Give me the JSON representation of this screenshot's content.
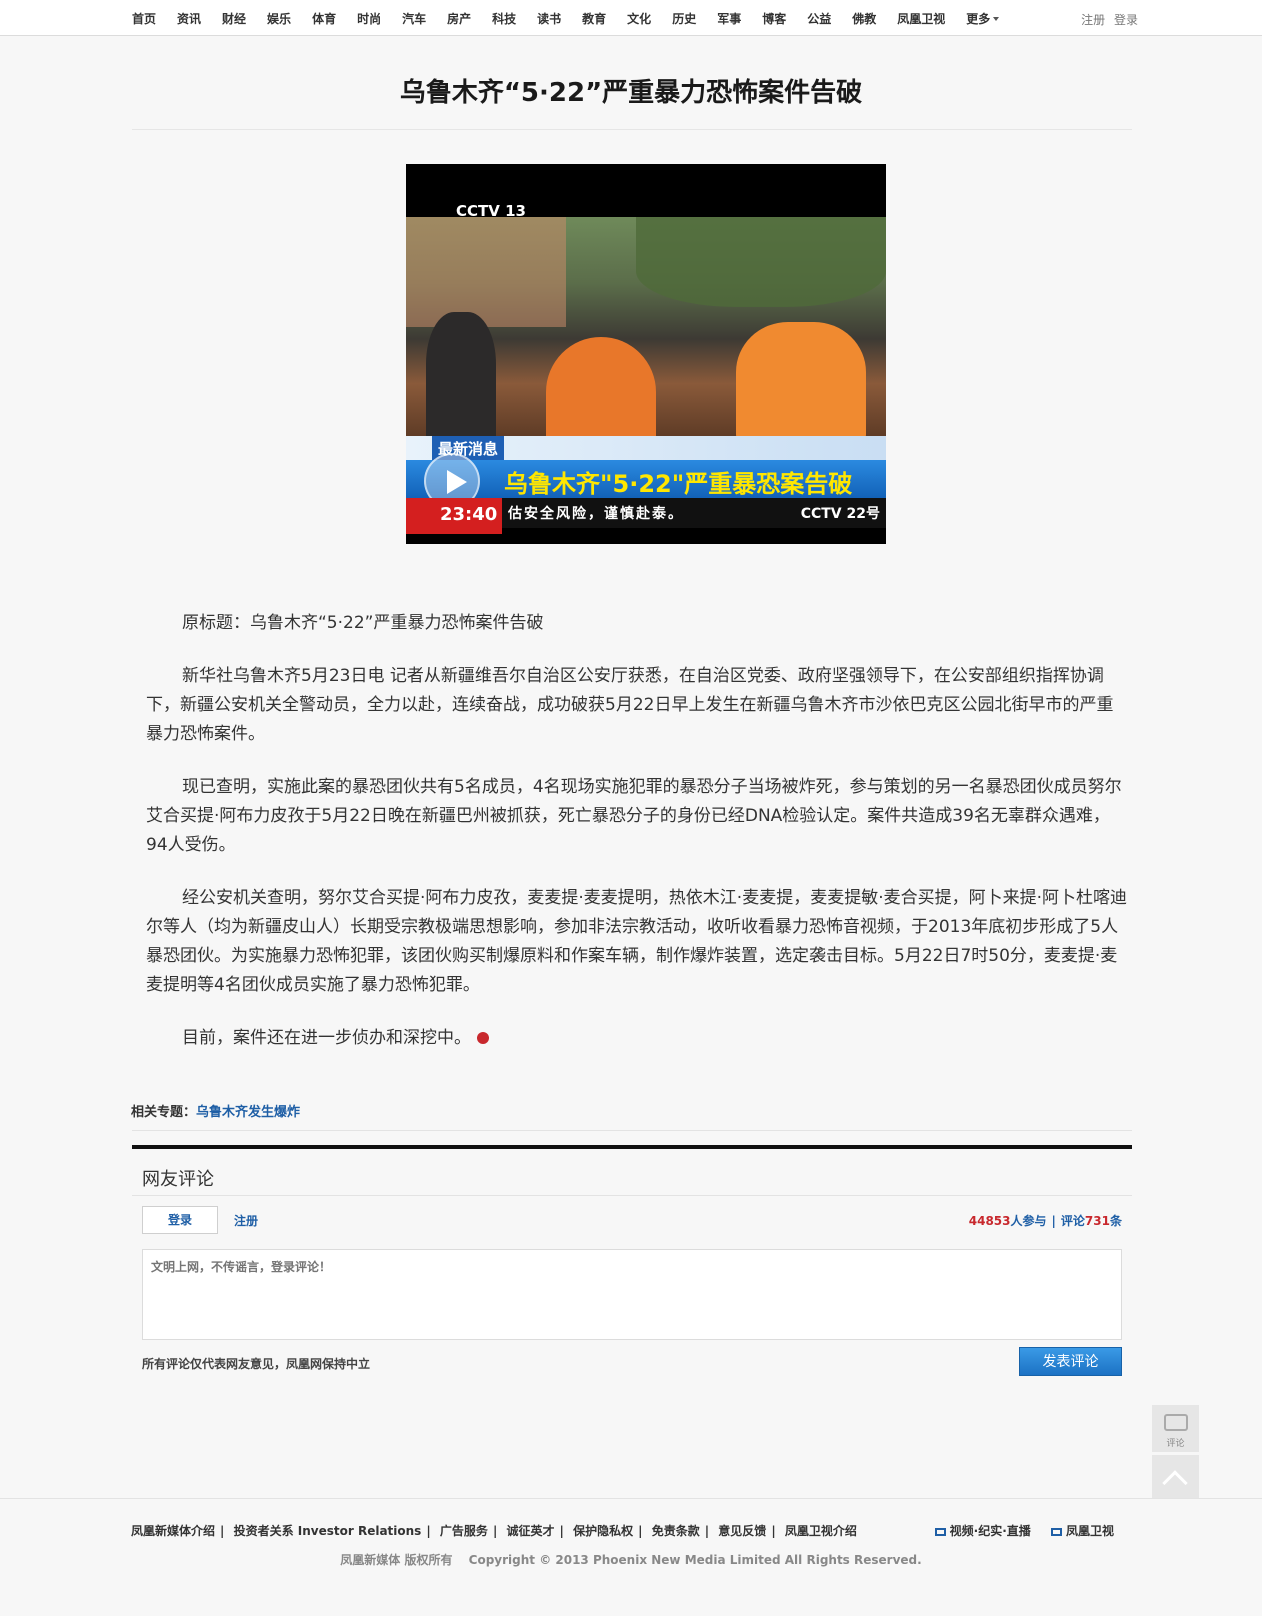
{
  "nav": {
    "items": [
      "首页",
      "资讯",
      "财经",
      "娱乐",
      "体育",
      "时尚",
      "汽车",
      "房产",
      "科技",
      "读书",
      "教育",
      "文化",
      "历史",
      "军事",
      "博客",
      "公益",
      "佛教",
      "凤凰卫视",
      "更多"
    ],
    "register": "注册",
    "login": "登录"
  },
  "article": {
    "title": "乌鲁木齐“5·22”严重暴力恐怖案件告破",
    "video": {
      "channel_logo": "CCTV 13",
      "breaking_label": "最新消息",
      "headline_overlay": "乌鲁木齐\"5·22\"严重暴恐案告破",
      "time": "23:40",
      "ticker": "估安全风险，谨慎赴泰。",
      "ticker_right": "CCTV 22号"
    },
    "paragraphs": [
      "原标题：乌鲁木齐“5·22”严重暴力恐怖案件告破",
      "新华社乌鲁木齐5月23日电  记者从新疆维吾尔自治区公安厅获悉，在自治区党委、政府坚强领导下，在公安部组织指挥协调下，新疆公安机关全警动员，全力以赴，连续奋战，成功破获5月22日早上发生在新疆乌鲁木齐市沙依巴克区公园北街早市的严重暴力恐怖案件。",
      "现已查明，实施此案的暴恐团伙共有5名成员，4名现场实施犯罪的暴恐分子当场被炸死，参与策划的另一名暴恐团伙成员努尔艾合买提·阿布力皮孜于5月22日晚在新疆巴州被抓获，死亡暴恐分子的身份已经DNA检验认定。案件共造成39名无辜群众遇难，94人受伤。",
      "经公安机关查明，努尔艾合买提·阿布力皮孜，麦麦提·麦麦提明，热依木江·麦麦提，麦麦提敏·麦合买提，阿卜来提·阿卜杜喀迪尔等人（均为新疆皮山人）长期受宗教极端思想影响，参加非法宗教活动，收听收看暴力恐怖音视频，于2013年底初步形成了5人暴恐团伙。为实施暴力恐怖犯罪，该团伙购买制爆原料和作案车辆，制作爆炸装置，选定袭击目标。5月22日7时50分，麦麦提·麦麦提明等4名团伙成员实施了暴力恐怖犯罪。",
      "目前，案件还在进一步侦办和深挖中。"
    ],
    "related_label": "相关专题：",
    "related_link": "乌鲁木齐发生爆炸"
  },
  "comments": {
    "heading": "网友评论",
    "login_button": "登录",
    "register_link": "注册",
    "participants": "44853",
    "participants_suffix": "人参与",
    "sep": "|",
    "comments_prefix": "评论",
    "comments_count": "731",
    "comments_suffix": "条",
    "placeholder": "文明上网，不传谣言，登录评论！",
    "disclaimer": "所有评论仅代表网友意见，凤凰网保持中立",
    "submit": "发表评论"
  },
  "floating": {
    "comment_label": "评论"
  },
  "footer": {
    "links": [
      "凤凰新媒体介绍",
      "投资者关系 Investor Relations",
      "广告服务",
      "诚征英才",
      "保护隐私权",
      "免责条款",
      "意见反馈",
      "凤凰卫视介绍"
    ],
    "right_links": [
      "视频·纪实·直播",
      "凤凰卫视"
    ],
    "copyright_left": "凤凰新媒体 版权所有",
    "copyright_right": "Copyright © 2013 Phoenix New Media Limited All Rights Reserved."
  },
  "colors": {
    "link": "#1f5fa6",
    "accent_red": "#c8282d",
    "submit_blue": "#1c72c4"
  }
}
